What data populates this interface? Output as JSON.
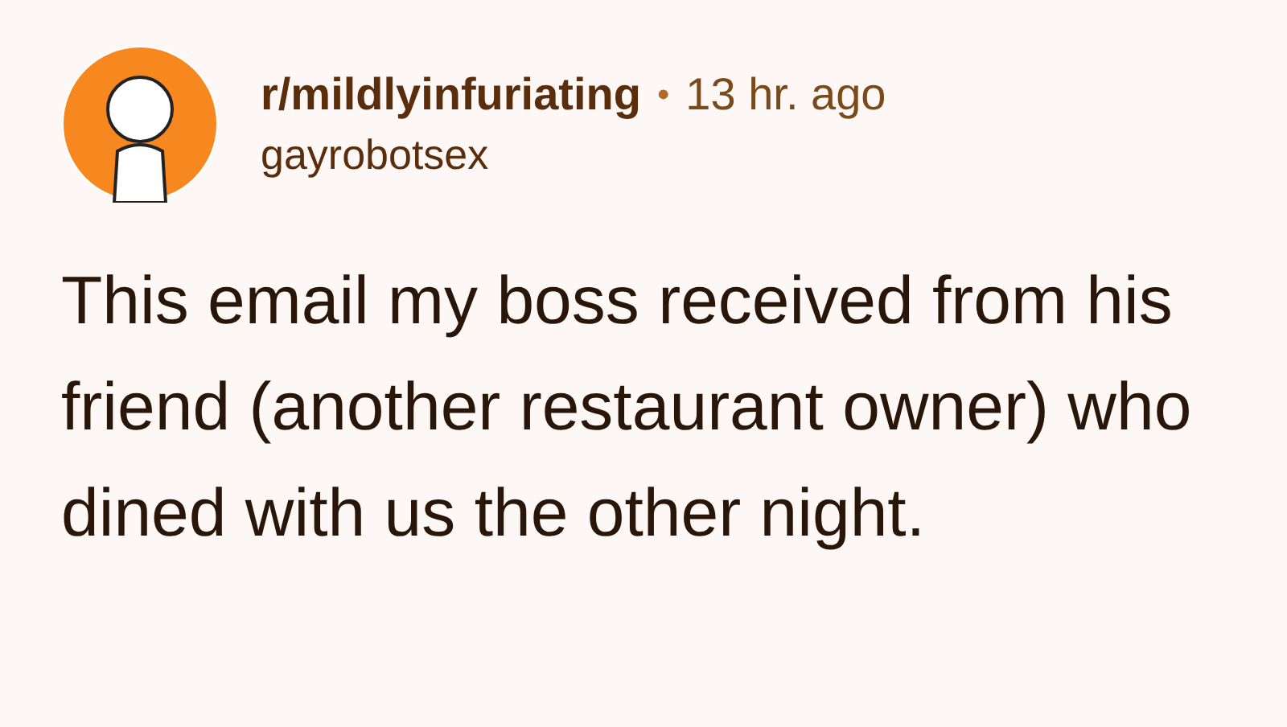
{
  "post": {
    "subreddit": "r/mildlyinfuriating",
    "separator": "•",
    "time": "13 hr. ago",
    "author": "gayrobotsex",
    "title": "This email my boss received from his friend (another restaurant owner) who dined with us the other night."
  }
}
